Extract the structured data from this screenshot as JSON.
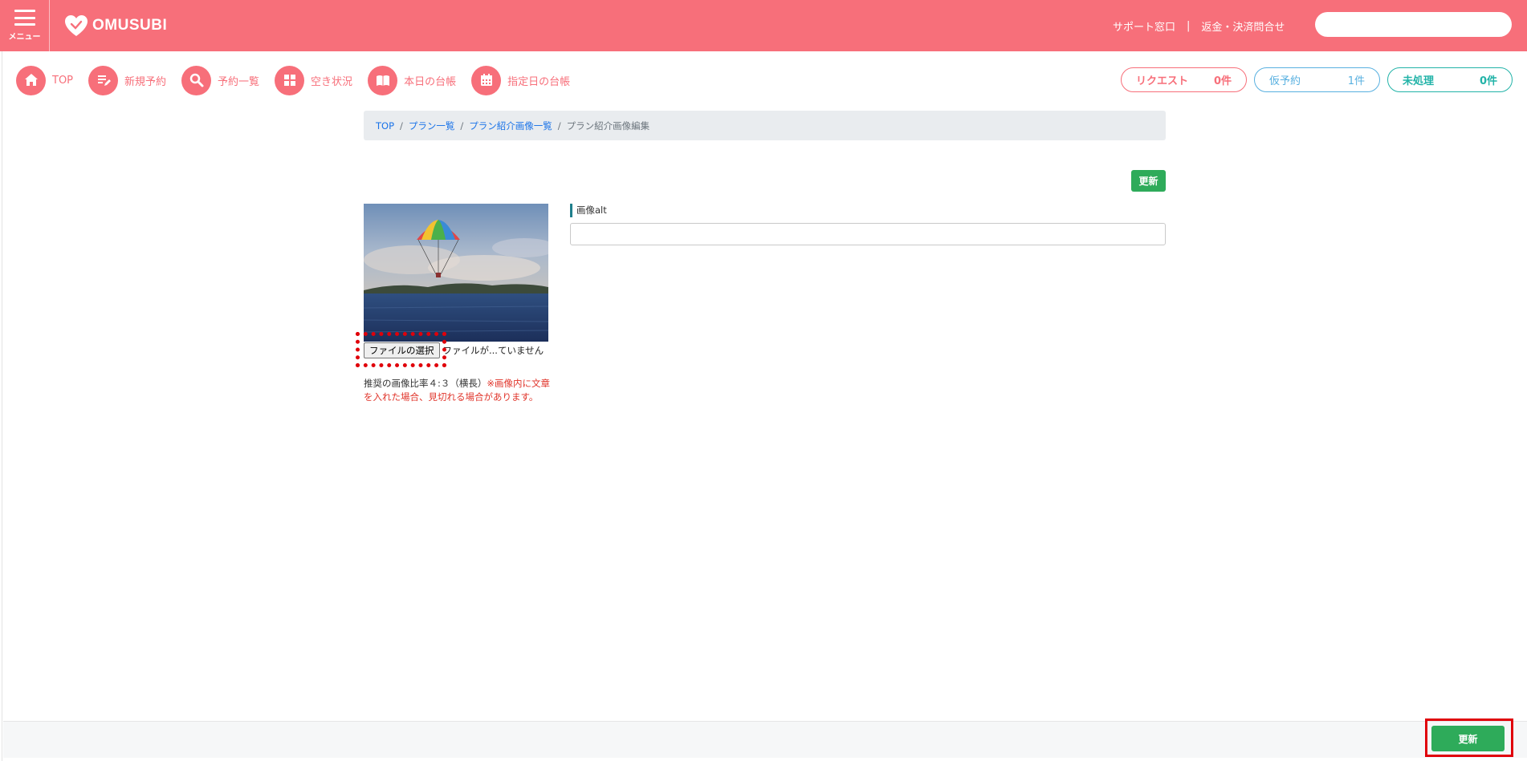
{
  "header": {
    "menu_label": "メニュー",
    "logo_text": "OMUSUBI",
    "support_link": "サポート窓口",
    "separator": "|",
    "refund_link": "返金・決済問合せ",
    "search_placeholder": "",
    "color": "#f76f7a"
  },
  "nav": {
    "items": [
      {
        "label": "TOP",
        "icon": "home-icon"
      },
      {
        "label": "新規予約",
        "icon": "new-reservation-icon"
      },
      {
        "label": "予約一覧",
        "icon": "search-icon"
      },
      {
        "label": "空き状況",
        "icon": "grid-icon"
      },
      {
        "label": "本日の台帳",
        "icon": "book-icon"
      },
      {
        "label": "指定日の台帳",
        "icon": "calendar-icon"
      }
    ]
  },
  "counters": {
    "request": {
      "label": "リクエスト",
      "count": "0件",
      "color": "#f76f7a"
    },
    "temporary": {
      "label": "仮予約",
      "count": "1件",
      "color": "#58b0e0"
    },
    "unprocessed": {
      "label": "未処理",
      "count": "0件",
      "color": "#22b3a8"
    }
  },
  "breadcrumb": {
    "items": [
      "TOP",
      "プラン一覧",
      "プラン紹介画像一覧"
    ],
    "current": "プラン紹介画像編集",
    "slash": "/"
  },
  "form": {
    "update_label": "更新",
    "file_button": "ファイルの選択",
    "file_status": "ファイルが...ていません",
    "note_normal": "推奨の画像比率４:３（横長）",
    "note_warning": "※画像内に文章を入れた場合、見切れる場合があります。",
    "alt_label": "画像alt",
    "alt_value": ""
  },
  "footer": {
    "update_label": "更新"
  }
}
